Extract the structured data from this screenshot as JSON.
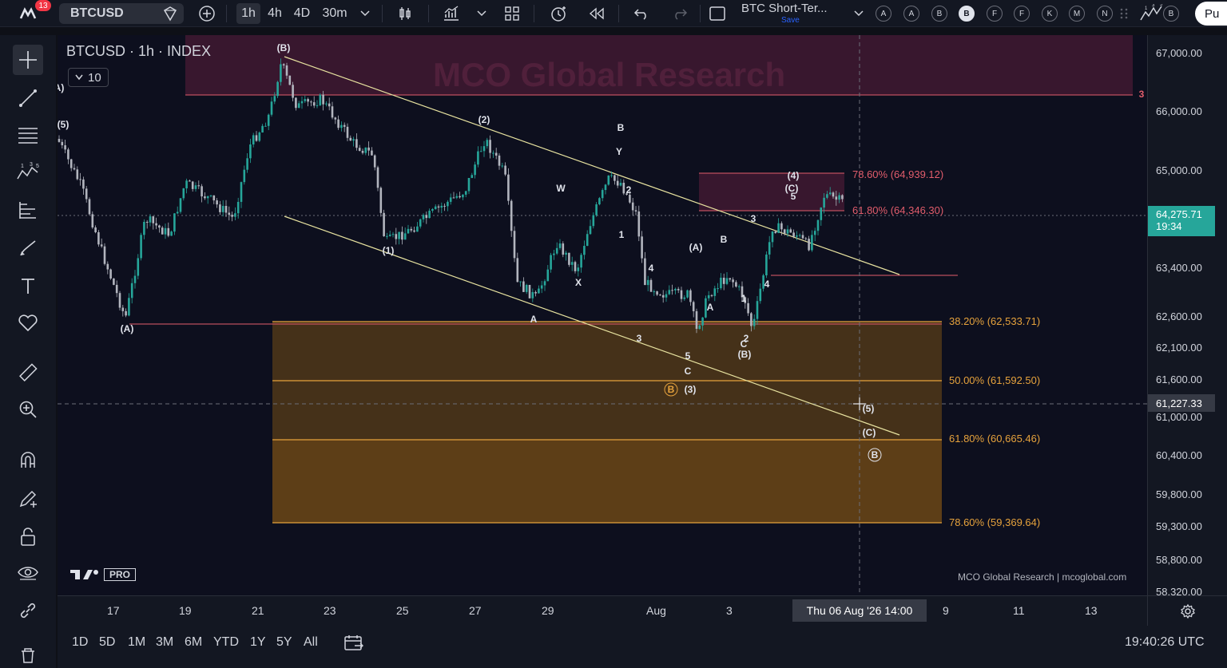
{
  "toolbar": {
    "notification_count": "13",
    "symbol": "BTCUSD",
    "timeframes": [
      "1h",
      "4h",
      "4D",
      "30m"
    ],
    "active_timeframe": "1h",
    "layout_name": "BTC Short-Ter...",
    "layout_save": "Save",
    "alert_buttons": [
      "A",
      "A",
      "B",
      "B",
      "F",
      "F",
      "K",
      "M",
      "N"
    ],
    "active_alert": 3,
    "publish_label": "Pu"
  },
  "chart": {
    "title": "BTCUSD · 1h · INDEX",
    "indicator_count": "10",
    "watermark": "MCO Global Research",
    "credit": "MCO Global Research | mcoglobal.com",
    "brand": "TV",
    "brand_badge": "PRO",
    "colors": {
      "up": "#26a69a",
      "down": "#b2b5be",
      "fib_zone": "#8a5a14",
      "fib_line": "#e6a23c",
      "trendline": "#e8e3a0",
      "resistance_zone": "#5c1f3d",
      "resistance_line": "#e25d6c"
    },
    "fib_labels": [
      {
        "text": "78.60% (64,939.12)",
        "color": "#e25d6c"
      },
      {
        "text": "61.80% (64,346.30)",
        "color": "#e25d6c"
      },
      {
        "text": "38.20% (62,533.71)",
        "color": "#e6a23c"
      },
      {
        "text": "50.00% (61,592.50)",
        "color": "#e6a23c"
      },
      {
        "text": "61.80% (60,665.46)",
        "color": "#e6a23c"
      },
      {
        "text": "78.60% (59,369.64)",
        "color": "#e6a23c"
      }
    ],
    "wave_labels": [
      "(B)",
      "(A)",
      "(5)",
      "(2)",
      "B",
      "Y",
      "W",
      "2",
      "1",
      "X",
      "4",
      "(1)",
      "A",
      "(A)",
      "B",
      "A",
      "1",
      "2",
      "C",
      "(B)",
      "3",
      "4",
      "3",
      "5",
      "C",
      "(3)",
      "B",
      "(4)",
      "(C)",
      "5",
      "(A)",
      "(5)",
      "(C)",
      "B",
      "3"
    ]
  },
  "price_axis": {
    "labels": [
      "67,000.00",
      "66,000.00",
      "65,000.00",
      "63,400.00",
      "62,600.00",
      "62,100.00",
      "61,600.00",
      "61,000.00",
      "60,400.00",
      "59,800.00",
      "59,300.00",
      "58,800.00",
      "58,320.00"
    ],
    "current_price": "64,275.71",
    "countdown": "19:34",
    "cursor_price": "61,227.33"
  },
  "time_axis": {
    "labels": [
      "17",
      "19",
      "21",
      "23",
      "25",
      "27",
      "29",
      "Aug",
      "3",
      "9",
      "11",
      "13"
    ],
    "cursor_label": "Thu 06 Aug '26   14:00"
  },
  "bottom_bar": {
    "ranges": [
      "1D",
      "5D",
      "1M",
      "3M",
      "6M",
      "YTD",
      "1Y",
      "5Y",
      "All"
    ],
    "clock": "19:40:26 UTC"
  }
}
